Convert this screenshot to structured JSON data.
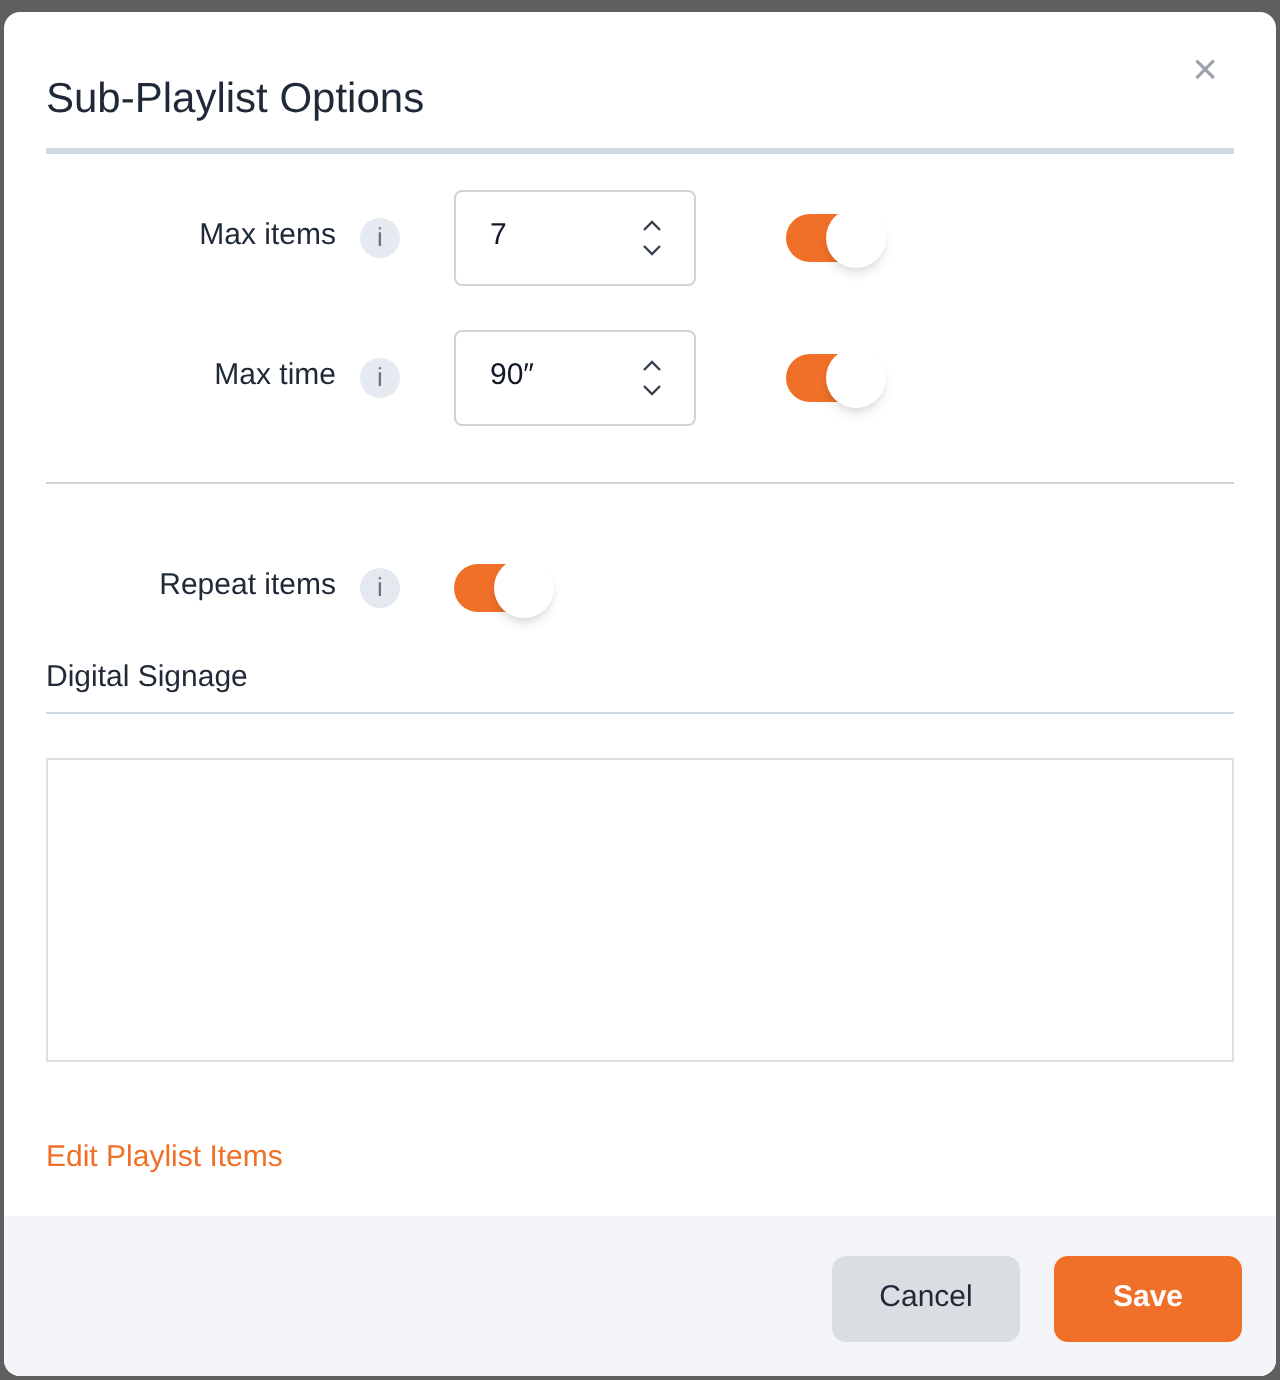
{
  "dialog": {
    "title": "Sub-Playlist Options",
    "close": "×"
  },
  "limits": [
    {
      "label": "Max items",
      "info": "i",
      "value": "7",
      "on": true
    },
    {
      "label": "Max time",
      "info": "i",
      "value": "90″",
      "on": true
    }
  ],
  "repeat": {
    "label": "Repeat items",
    "info": "i",
    "on": true
  },
  "section": {
    "title": "Digital Signage"
  },
  "link": "Edit Playlist Items",
  "buttons": [
    {
      "label": "Cancel",
      "kind": "secondary"
    },
    {
      "label": "Save",
      "kind": "primary"
    }
  ]
}
